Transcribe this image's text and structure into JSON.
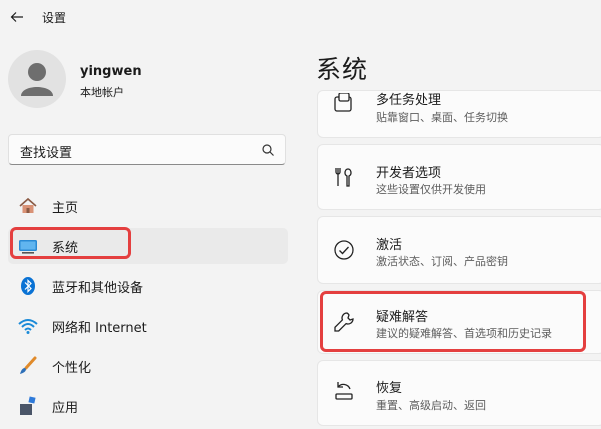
{
  "window": {
    "title": "设置"
  },
  "user": {
    "name": "yingwen",
    "account_type": "本地帐户"
  },
  "search": {
    "placeholder": "查找设置"
  },
  "nav": [
    {
      "label": "主页",
      "icon": "home-icon"
    },
    {
      "label": "系统",
      "icon": "system-icon",
      "selected": true
    },
    {
      "label": "蓝牙和其他设备",
      "icon": "bluetooth-icon"
    },
    {
      "label": "网络和 Internet",
      "icon": "network-icon"
    },
    {
      "label": "个性化",
      "icon": "brush-icon"
    },
    {
      "label": "应用",
      "icon": "apps-icon"
    }
  ],
  "page": {
    "title": "系统"
  },
  "cards": [
    {
      "title": "多任务处理",
      "subtitle": "贴靠窗口、桌面、任务切换",
      "icon": "multitasking-icon"
    },
    {
      "title": "开发者选项",
      "subtitle": "这些设置仅供开发使用",
      "icon": "developer-tools-icon"
    },
    {
      "title": "激活",
      "subtitle": "激活状态、订阅、产品密钥",
      "icon": "activation-check-icon"
    },
    {
      "title": "疑难解答",
      "subtitle": "建议的疑难解答、首选项和历史记录",
      "icon": "wrench-icon"
    },
    {
      "title": "恢复",
      "subtitle": "重置、高级启动、返回",
      "icon": "recovery-icon"
    }
  ],
  "colors": {
    "highlight": "#e43f3f",
    "accent": "#0067c0"
  }
}
